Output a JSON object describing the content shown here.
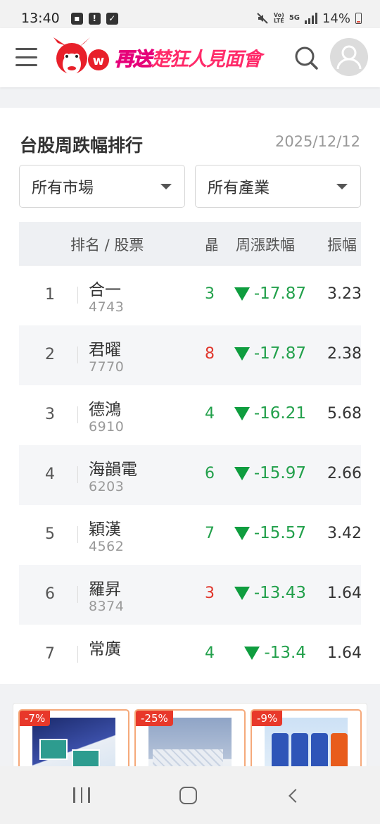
{
  "status_bar": {
    "time": "13:40",
    "volte_label_top": "Vo)",
    "volte_label_bottom": "LTE",
    "network": "5G",
    "battery": "14%"
  },
  "header": {
    "slogan_part1": "再送",
    "slogan_part2": "楚狂人見面會",
    "logo_letter": "w"
  },
  "section": {
    "title": "台股周跌幅排行",
    "date": "2025/12/12"
  },
  "filters": {
    "market": "所有市場",
    "industry": "所有產業"
  },
  "table": {
    "headers": {
      "rank_stock": "排名 / 股票",
      "partial": "晶",
      "weekly_change": "周漲跌幅",
      "amplitude": "振幅"
    },
    "rows": [
      {
        "rank": "1",
        "name": "合一",
        "code": "4743",
        "count": "3",
        "count_color": "green",
        "change": "-17.87",
        "amplitude": "3.23"
      },
      {
        "rank": "2",
        "name": "君曜",
        "code": "7770",
        "count": "8",
        "count_color": "red",
        "change": "-17.87",
        "amplitude": "2.38"
      },
      {
        "rank": "3",
        "name": "德鴻",
        "code": "6910",
        "count": "4",
        "count_color": "green",
        "change": "-16.21",
        "amplitude": "5.68"
      },
      {
        "rank": "4",
        "name": "海韻電",
        "code": "6203",
        "count": "6",
        "count_color": "green",
        "change": "-15.97",
        "amplitude": "2.66"
      },
      {
        "rank": "5",
        "name": "穎漢",
        "code": "4562",
        "count": "7",
        "count_color": "green",
        "change": "-15.57",
        "amplitude": "3.42"
      },
      {
        "rank": "6",
        "name": "羅昇",
        "code": "8374",
        "count": "3",
        "count_color": "red",
        "change": "-13.43",
        "amplitude": "1.64"
      },
      {
        "rank": "7",
        "name": "常廣",
        "code": "",
        "count": "4",
        "count_color": "green",
        "change": "-13.4",
        "amplitude": "1.64"
      }
    ]
  },
  "ads": [
    {
      "discount": "-7%"
    },
    {
      "discount": "-25%"
    },
    {
      "discount": "-9%"
    }
  ],
  "colors": {
    "down": "#22a04b",
    "up": "#e0352b",
    "brand": "#e8202a"
  }
}
